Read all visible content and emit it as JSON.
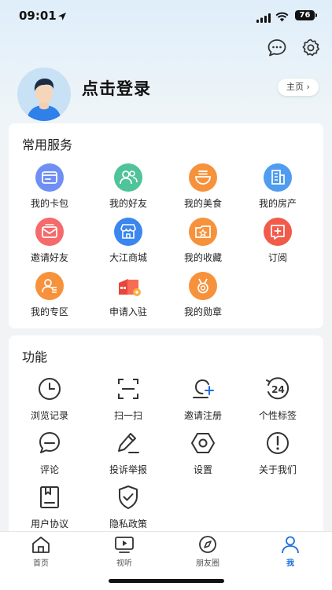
{
  "status_bar": {
    "time": "09:01",
    "battery": "76"
  },
  "header": {
    "login_text": "点击登录",
    "homepage_label": "主页"
  },
  "services": {
    "title": "常用服务",
    "items": [
      {
        "label": "我的卡包",
        "icon": "wallet-icon",
        "color": "#6f8ff5"
      },
      {
        "label": "我的好友",
        "icon": "friends-icon",
        "color": "#4fc39a"
      },
      {
        "label": "我的美食",
        "icon": "food-icon",
        "color": "#f7923c"
      },
      {
        "label": "我的房产",
        "icon": "building-icon",
        "color": "#4f9cf0"
      },
      {
        "label": "邀请好友",
        "icon": "invite-envelope-icon",
        "color": "#f56a6a"
      },
      {
        "label": "大江商城",
        "icon": "store-icon",
        "color": "#3b86ef"
      },
      {
        "label": "我的收藏",
        "icon": "collection-icon",
        "color": "#f7923c"
      },
      {
        "label": "订阅",
        "icon": "subscribe-icon",
        "color": "#f25a4a"
      },
      {
        "label": "我的专区",
        "icon": "zone-icon",
        "color": "#f7923c"
      },
      {
        "label": "申请入驻",
        "icon": "apply-icon",
        "color": "#ef5b45"
      },
      {
        "label": "我的勋章",
        "icon": "medal-icon",
        "color": "#f7923c"
      }
    ]
  },
  "functions": {
    "title": "功能",
    "items": [
      {
        "label": "浏览记录",
        "icon": "clock-icon"
      },
      {
        "label": "扫一扫",
        "icon": "scan-icon"
      },
      {
        "label": "邀请注册",
        "icon": "invite-register-icon"
      },
      {
        "label": "个性标签",
        "icon": "tag-24-icon",
        "badge": "24"
      },
      {
        "label": "评论",
        "icon": "comment-icon"
      },
      {
        "label": "投诉举报",
        "icon": "report-pen-icon"
      },
      {
        "label": "设置",
        "icon": "settings-hex-icon"
      },
      {
        "label": "关于我们",
        "icon": "info-icon"
      },
      {
        "label": "用户协议",
        "icon": "agreement-icon"
      },
      {
        "label": "隐私政策",
        "icon": "shield-check-icon"
      }
    ]
  },
  "tabbar": {
    "tabs": [
      {
        "label": "首页",
        "icon": "home-icon",
        "active": false
      },
      {
        "label": "视听",
        "icon": "video-icon",
        "active": false
      },
      {
        "label": "朋友圈",
        "icon": "compass-icon",
        "active": false
      },
      {
        "label": "我",
        "icon": "person-icon",
        "active": true
      }
    ],
    "active_color": "#1d6fe0"
  }
}
